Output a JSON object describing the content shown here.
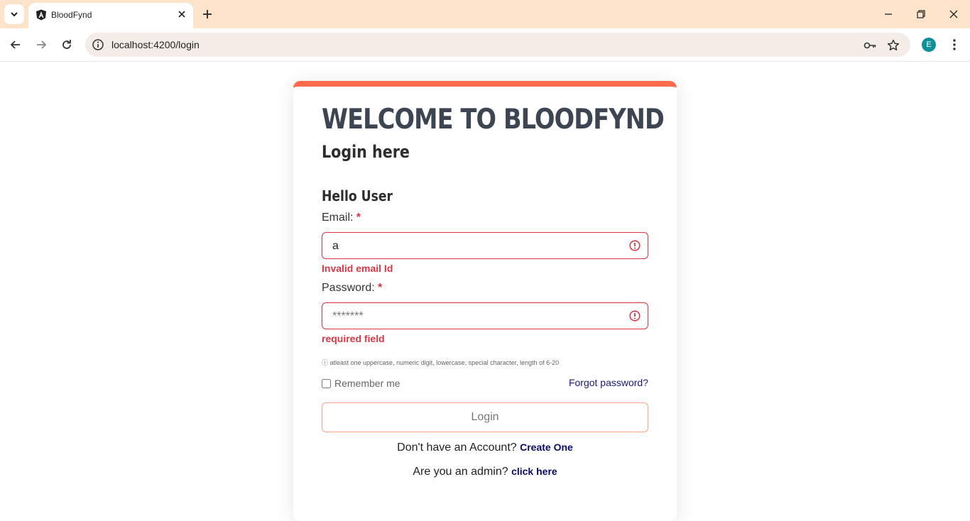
{
  "browser": {
    "tab_title": "BloodFynd",
    "url": "localhost:4200/login",
    "profile_initial": "E"
  },
  "page": {
    "title": "WELCOME TO BLOODFYND",
    "subtitle": "Login here",
    "greeting": "Hello User",
    "email_label": "Email:",
    "email_value": "a",
    "email_error": "Invalid email Id",
    "password_label": "Password:",
    "password_placeholder": "*******",
    "password_error": "required field",
    "password_hint": "ⓘ atleast one uppercase, numeric digit, lowercase, special character, length of 6-20",
    "remember_label": "Remember me",
    "forgot_link": "Forgot password?",
    "login_button": "Login",
    "signup_prompt": "Don't have an Account?",
    "signup_link": "Create One",
    "admin_prompt": "Are you an admin?",
    "admin_link": "click here",
    "required_mark": "*"
  },
  "colors": {
    "accent": "#ff6a4b",
    "error": "#dc3545",
    "link": "#1a1a7a",
    "tabbar": "#fde3c9"
  }
}
